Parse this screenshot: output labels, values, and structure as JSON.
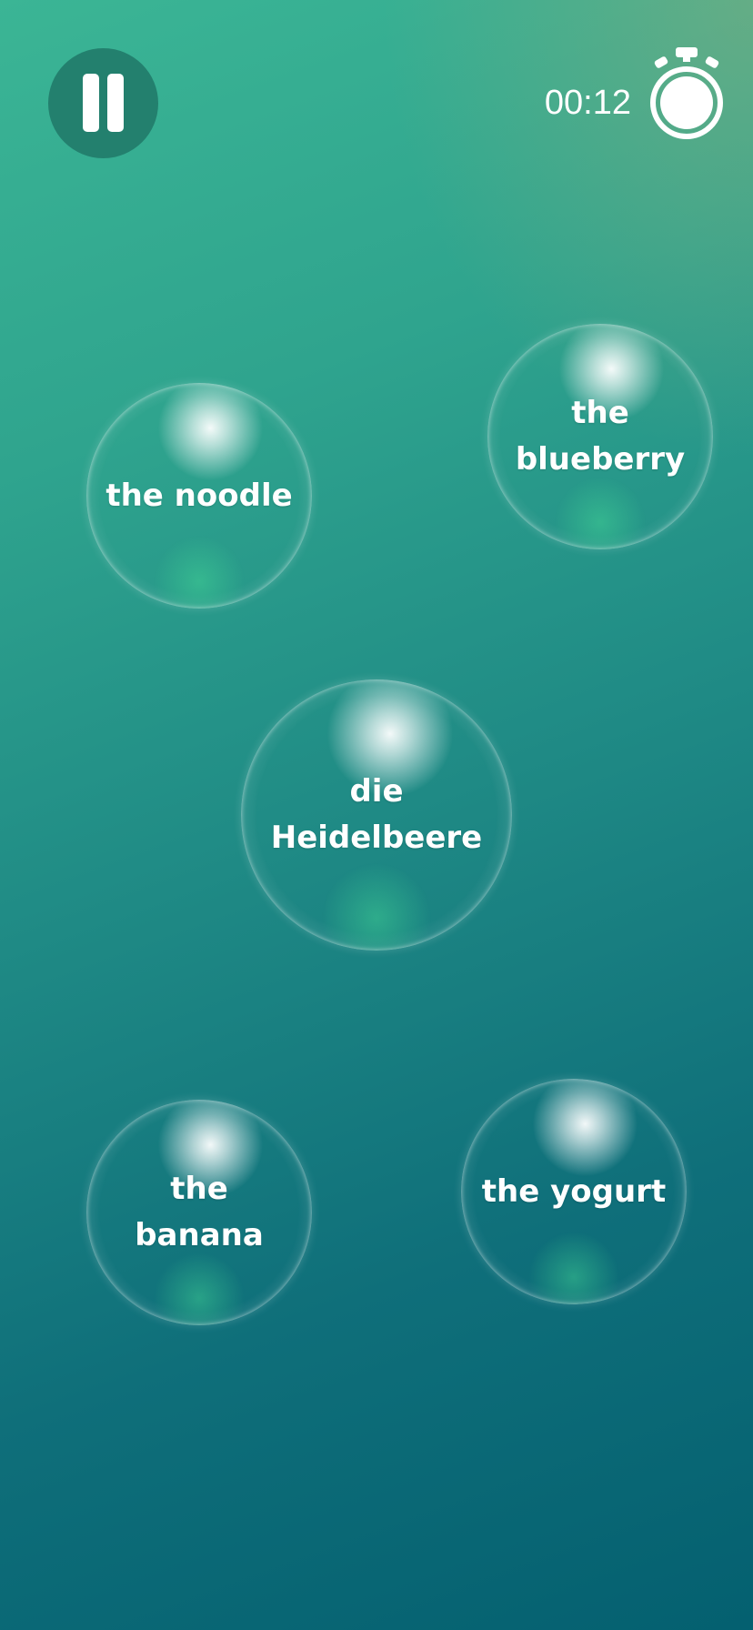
{
  "header": {
    "pause_icon": "pause-icon",
    "timer": "00:12",
    "timer_icon": "stopwatch-icon"
  },
  "bubbles": [
    {
      "label": "the blueberry"
    },
    {
      "label": "the noodle"
    },
    {
      "label": "die Heidelbeere"
    },
    {
      "label": "the yogurt"
    },
    {
      "label": "the banana"
    }
  ],
  "colors": {
    "background_top": "#3bb595",
    "background_bottom": "#046070",
    "pause_button_bg": "#23806e",
    "text": "#ffffff"
  }
}
